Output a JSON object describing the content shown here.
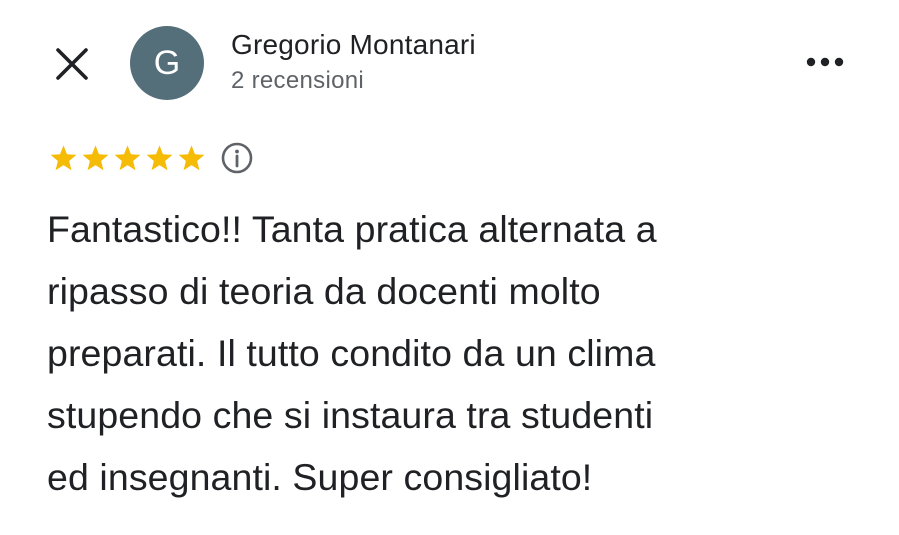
{
  "header": {
    "close_icon": "close-icon",
    "more_icon": "more-horizontal-icon"
  },
  "author": {
    "avatar_initial": "G",
    "avatar_color": "#546e7a",
    "name": "Gregorio Montanari",
    "meta": "2 recensioni"
  },
  "rating": {
    "stars": 5,
    "max_stars": 5,
    "star_color": "#f6bb06",
    "star_icon": "star-icon",
    "info_icon": "info-icon"
  },
  "review": {
    "lines": [
      "Fantastico!! Tanta pratica alternata a",
      "ripasso di teoria da docenti molto",
      "preparati. Il tutto condito da un clima",
      "stupendo che si instaura tra studenti",
      "ed insegnanti. Super consigliato!"
    ]
  }
}
